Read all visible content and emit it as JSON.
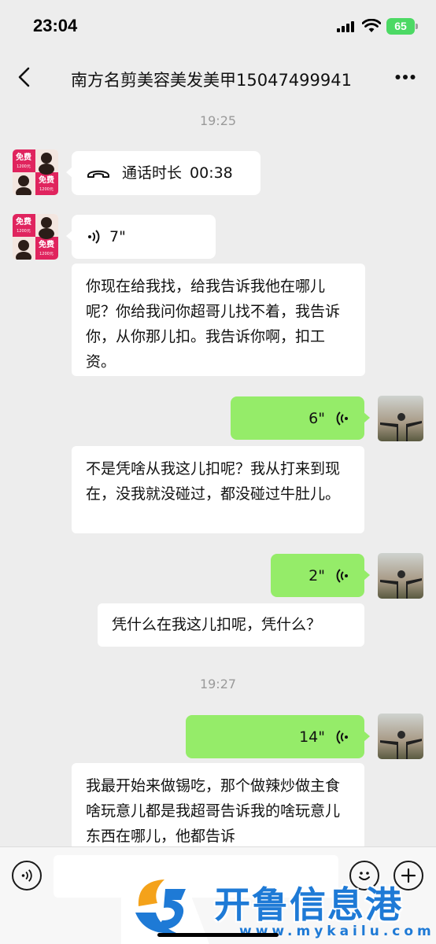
{
  "status": {
    "time": "23:04",
    "battery": "65"
  },
  "nav": {
    "title": "南方名剪美容美发美甲15047499941"
  },
  "dividers": [
    "19:25",
    "19:27"
  ],
  "avatar_ad": {
    "line1": "免费",
    "line2": "1200元",
    "line3": "免费",
    "line4": "1200元"
  },
  "messages": {
    "call": {
      "label": "通话时长",
      "duration": "00:38"
    },
    "voice_in_1": {
      "duration": "7\""
    },
    "text_1": {
      "text": "你现在给我找，给我告诉我他在哪儿呢？你给我问你超哥儿找不着，我告诉你，从你那儿扣。我告诉你啊，扣工资。"
    },
    "voice_out_1": {
      "duration": "6\""
    },
    "text_2": {
      "text": "不是凭啥从我这儿扣呢？我从打来到现在，没我就没碰过，都没碰过牛肚儿。"
    },
    "voice_out_2": {
      "duration": "2\""
    },
    "text_3": {
      "text": "凭什么在我这儿扣呢，凭什么？"
    },
    "voice_out_3": {
      "duration": "14\""
    },
    "text_4": {
      "text": "我最开始来做锡吃，那个做辣炒做主食啥玩意儿都是我超哥告诉我的啥玩意儿东西在哪儿，他都告诉"
    }
  },
  "watermark": {
    "name": "开鲁信息港",
    "url": "www.mykailu.com"
  },
  "colors": {
    "green_bubble": "#95ec69",
    "background": "#ededed",
    "watermark": "#1e7ad6"
  }
}
